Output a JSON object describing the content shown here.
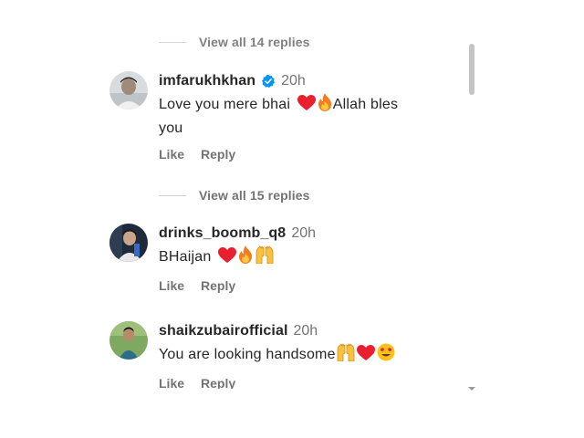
{
  "threads": [
    {
      "view_replies": "View all 14 replies"
    },
    {
      "view_replies": "View all 15 replies"
    }
  ],
  "comments": [
    {
      "username": "imfarukhkhan",
      "verified": true,
      "time": "20h",
      "text_line1": "Love you mere bhai",
      "text_after": "Allah bles",
      "text_line2": "you",
      "emojis": [
        "red-heart",
        "fire"
      ],
      "like_label": "Like",
      "reply_label": "Reply"
    },
    {
      "username": "drinks_boomb_q8",
      "verified": false,
      "time": "20h",
      "text_line1": "BHaijan",
      "emojis": [
        "red-heart",
        "fire",
        "raising-hands"
      ],
      "like_label": "Like",
      "reply_label": "Reply"
    },
    {
      "username": "shaikzubairofficial",
      "verified": false,
      "time": "20h",
      "text_line1": "You are looking handsome",
      "emojis": [
        "raising-hands",
        "red-heart",
        "heart-eyes"
      ],
      "like_label": "Like",
      "reply_label": "Reply"
    }
  ],
  "colors": {
    "text": "#262626",
    "muted": "#737373",
    "verified": "#0095f6",
    "heart": "#e8202f",
    "fire": "#f57b20"
  }
}
